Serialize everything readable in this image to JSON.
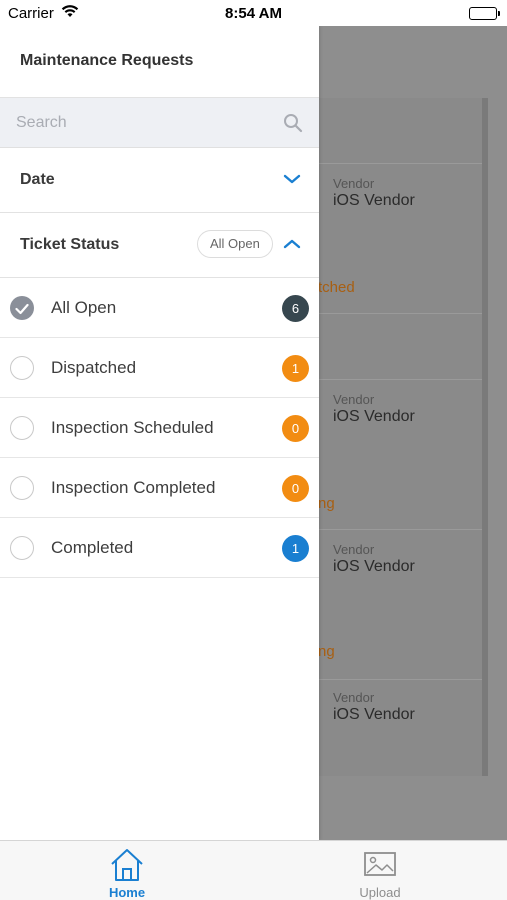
{
  "status_bar": {
    "carrier": "Carrier",
    "time": "8:54 AM"
  },
  "drawer": {
    "title": "Maintenance Requests",
    "search": {
      "placeholder": "Search",
      "value": ""
    },
    "date_section": {
      "label": "Date"
    },
    "ticket_status_section": {
      "label": "Ticket Status",
      "selected_pill": "All Open"
    },
    "status_items": [
      {
        "label": "All Open",
        "count": "6",
        "checked": true,
        "badge_color": "#37474f"
      },
      {
        "label": "Dispatched",
        "count": "1",
        "checked": false,
        "badge_color": "#f28c12"
      },
      {
        "label": "Inspection Scheduled",
        "count": "0",
        "checked": false,
        "badge_color": "#f28c12"
      },
      {
        "label": "Inspection Completed",
        "count": "0",
        "checked": false,
        "badge_color": "#f28c12"
      },
      {
        "label": "Completed",
        "count": "1",
        "checked": false,
        "badge_color": "#1a7fd1"
      }
    ]
  },
  "background_list": {
    "vendor_label": "Vendor",
    "vendor_name": "iOS Vendor",
    "status_fragments": [
      "tched",
      "ng",
      "ng"
    ]
  },
  "tab_bar": {
    "tabs": [
      {
        "label": "Home",
        "icon": "home-icon",
        "active": true
      },
      {
        "label": "Upload",
        "icon": "image-icon",
        "active": false
      }
    ]
  },
  "colors": {
    "accent": "#1a7fd1",
    "inactive_tab": "#8e8e8e"
  }
}
